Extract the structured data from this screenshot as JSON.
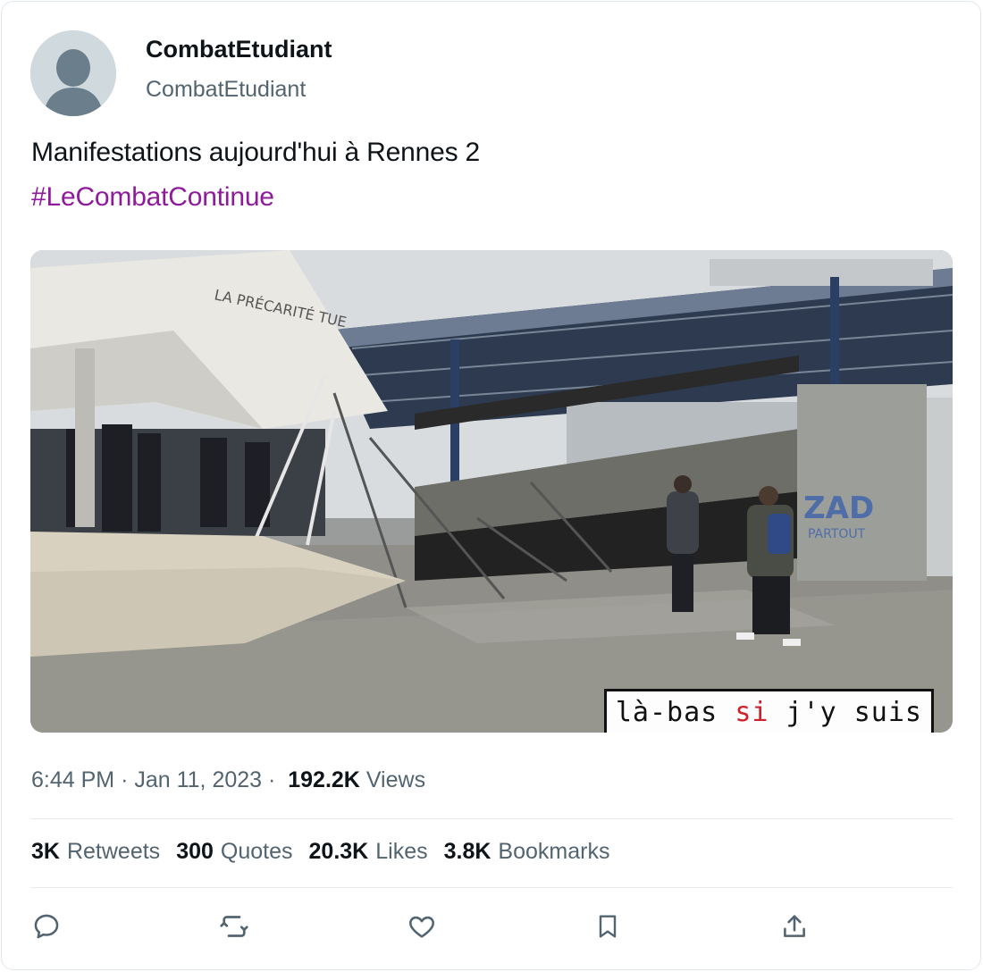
{
  "author": {
    "display_name": "CombatEtudiant",
    "handle": "CombatEtudiant",
    "avatar_icon": "default-avatar-icon"
  },
  "tweet": {
    "text": "Manifestations aujourd'hui à Rennes 2",
    "hashtag": "#LeCombatContinue",
    "hashtag_color": "#8e1b9b"
  },
  "media": {
    "graffiti_1": "LA PRÉCARITÉ TUE",
    "graffiti_2": "ZAD",
    "graffiti_3": "PARTOUT",
    "caption_part1": "là-bas ",
    "caption_red": "si",
    "caption_part2": " j'y suis"
  },
  "meta": {
    "time": "6:44 PM",
    "sep1": "·",
    "date": "Jan 11, 2023",
    "sep2": "·",
    "views_count": "192.2K",
    "views_label": "Views"
  },
  "stats": [
    {
      "count": "3K",
      "label": "Retweets"
    },
    {
      "count": "300",
      "label": "Quotes"
    },
    {
      "count": "20.3K",
      "label": "Likes"
    },
    {
      "count": "3.8K",
      "label": "Bookmarks"
    }
  ],
  "actions": {
    "reply_icon": "reply-icon",
    "retweet_icon": "retweet-icon",
    "like_icon": "heart-icon",
    "bookmark_icon": "bookmark-icon",
    "share_icon": "share-icon"
  },
  "colors": {
    "text_primary": "#0f1419",
    "text_secondary": "#536471",
    "border": "#e1e8ed"
  }
}
